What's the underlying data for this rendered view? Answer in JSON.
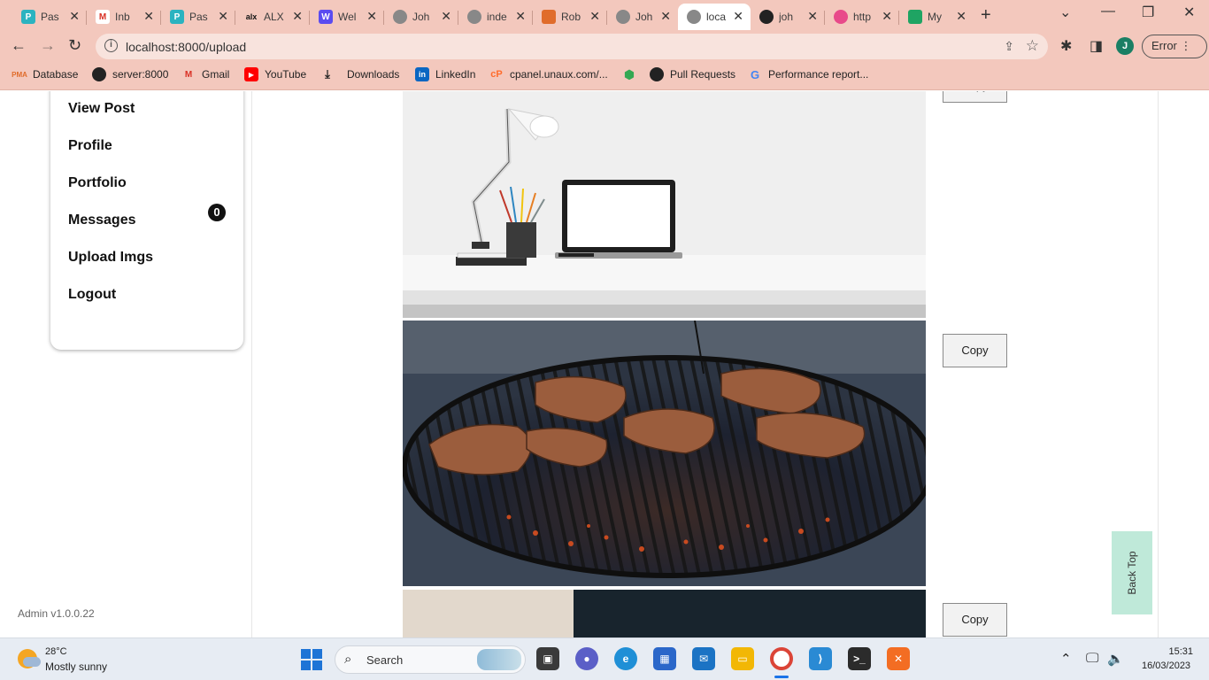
{
  "browser": {
    "tabs": [
      {
        "label": "Pas",
        "icon": "p-icon",
        "color": "#2bb3c0"
      },
      {
        "label": "Inb",
        "icon": "gmail-icon",
        "color": "#d93025"
      },
      {
        "label": "Pas",
        "icon": "p-icon",
        "color": "#2bb3c0"
      },
      {
        "label": "ALX",
        "icon": "alx-icon",
        "color": "#111111"
      },
      {
        "label": "Wel",
        "icon": "w-icon",
        "color": "#5b4cf0"
      },
      {
        "label": "Joh",
        "icon": "globe-icon",
        "color": "#777777"
      },
      {
        "label": "inde",
        "icon": "globe-icon",
        "color": "#777777"
      },
      {
        "label": "Rob",
        "icon": "rob-icon",
        "color": "#e06c2b"
      },
      {
        "label": "Joh",
        "icon": "globe-icon",
        "color": "#777777"
      },
      {
        "label": "loca",
        "icon": "globe-icon",
        "color": "#777777"
      },
      {
        "label": "joh",
        "icon": "github-icon",
        "color": "#222222"
      },
      {
        "label": "http",
        "icon": "dribbble-icon",
        "color": "#e84a8a"
      },
      {
        "label": "My",
        "icon": "drive-icon",
        "color": "#1fa463"
      }
    ],
    "url": "localhost:8000/upload",
    "profile_initial": "J",
    "error_label": "Error",
    "bookmarks": [
      {
        "label": "Database",
        "icon": "pma-icon"
      },
      {
        "label": "server:8000",
        "icon": "globe-icon"
      },
      {
        "label": "Gmail",
        "icon": "gmail-icon"
      },
      {
        "label": "YouTube",
        "icon": "youtube-icon"
      },
      {
        "label": "Downloads",
        "icon": "download-icon"
      },
      {
        "label": "LinkedIn",
        "icon": "linkedin-icon"
      },
      {
        "label": "cpanel.unaux.com/...",
        "icon": "cpanel-icon"
      },
      {
        "label": "",
        "icon": "maps-icon"
      },
      {
        "label": "Pull Requests",
        "icon": "github-icon"
      },
      {
        "label": "Performance report...",
        "icon": "google-icon"
      }
    ]
  },
  "sidebar": {
    "items": [
      {
        "label": "View Post"
      },
      {
        "label": "Profile"
      },
      {
        "label": "Portfolio"
      },
      {
        "label": "Messages"
      },
      {
        "label": "Upload Imgs"
      },
      {
        "label": "Logout"
      }
    ],
    "messages_count": "0",
    "version": "Admin v1.0.0.22"
  },
  "main": {
    "images": [
      {
        "subject": "white desk lamp, pencil cup and laptop on a white desk"
      },
      {
        "subject": "meat grilling on a round charcoal barbecue grate"
      },
      {
        "subject": "partially visible image"
      }
    ],
    "copy_label": "Copy",
    "back_top_label": "Back Top"
  },
  "taskbar": {
    "temperature": "28°C",
    "condition": "Mostly sunny",
    "search_placeholder": "Search",
    "time": "15:31",
    "date": "16/03/2023"
  }
}
